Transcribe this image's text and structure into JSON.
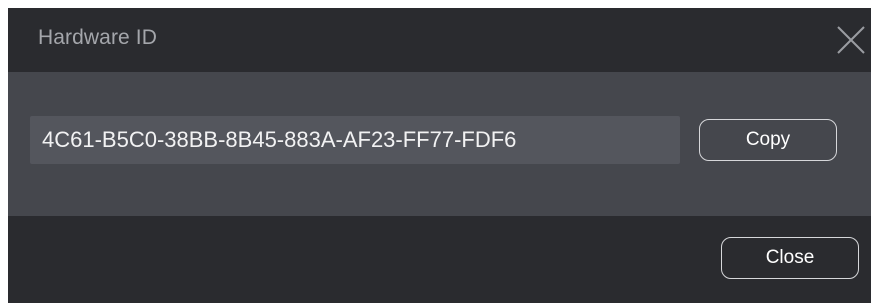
{
  "dialog": {
    "title": "Hardware ID",
    "close_icon": "close-icon"
  },
  "hwid": {
    "value": "4C61-B5C0-38BB-8B45-883A-AF23-FF77-FDF6"
  },
  "actions": {
    "copy_label": "Copy",
    "close_label": "Close"
  },
  "colors": {
    "titlebar_bg": "#2a2b2f",
    "body_bg": "#45474d",
    "field_bg": "#54565d",
    "title_text": "#a4a6ab",
    "button_border": "#d6d7da"
  }
}
